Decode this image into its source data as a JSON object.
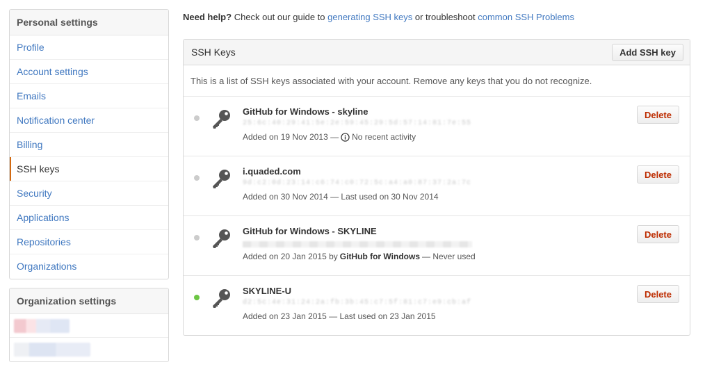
{
  "sidebar": {
    "personal_heading": "Personal settings",
    "items": [
      {
        "label": "Profile",
        "selected": false
      },
      {
        "label": "Account settings",
        "selected": false
      },
      {
        "label": "Emails",
        "selected": false
      },
      {
        "label": "Notification center",
        "selected": false
      },
      {
        "label": "Billing",
        "selected": false
      },
      {
        "label": "SSH keys",
        "selected": true
      },
      {
        "label": "Security",
        "selected": false
      },
      {
        "label": "Applications",
        "selected": false
      },
      {
        "label": "Repositories",
        "selected": false
      },
      {
        "label": "Organizations",
        "selected": false
      }
    ],
    "org_heading": "Organization settings"
  },
  "help": {
    "lead": "Need help?",
    "text1": "Check out our guide to",
    "link1": "generating SSH keys",
    "text2": "or troubleshoot",
    "link2": "common SSH Problems"
  },
  "ssh": {
    "title": "SSH Keys",
    "add_button": "Add SSH key",
    "description": "This is a list of SSH keys associated with your account. Remove any keys that you do not recognize.",
    "delete_label": "Delete",
    "keys": [
      {
        "title": "GitHub for Windows - skyline",
        "fingerprint": "25:6c:40:29:41:5e:2e:59:45:29:5d:57:14:81:7e:55",
        "added": "Added on 19 Nov 2013 —",
        "usage": "No recent activity",
        "active": false
      },
      {
        "title": "i.quaded.com",
        "fingerprint": "9d:c2:0d:23:14:c6:74:c0:72:5c:a4:a0:87:37:2a:7c",
        "added": "Added on 30 Nov 2014 — Last used on 30 Nov 2014",
        "active": false
      },
      {
        "title": "GitHub for Windows - SKYLINE",
        "added_prefix": "Added on 20 Jan 2015 by",
        "added_by": "GitHub for Windows",
        "added_suffix": "— Never used",
        "active": false
      },
      {
        "title": "SKYLINE-U",
        "fingerprint": "d2:5c:4e:31:24:2a:fb:3b:45:c7:5f:81:c7:e9:cb:af",
        "added": "Added on 23 Jan 2015 — Last used on 23 Jan 2015",
        "active": true
      }
    ]
  },
  "colors": {
    "link": "#4078c0",
    "delete": "#bd2c00",
    "selected_accent": "#d26911",
    "active_dot": "#6cc644",
    "inactive_dot": "#cccccc"
  }
}
